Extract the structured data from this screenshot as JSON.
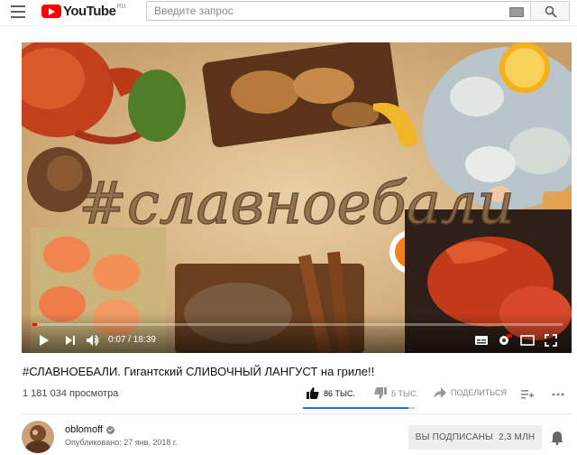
{
  "header": {
    "logo_text": "YouTube",
    "logo_country": "RU",
    "search_placeholder": "Введите запрос"
  },
  "player": {
    "overlay_text": "#славноебали",
    "current_time": "0:07",
    "duration": "18:39",
    "time_display": "0:07 / 18:39",
    "progress_fraction": 0.006
  },
  "video": {
    "title": "#СЛАВНОЕБАЛИ. Гигантский СЛИВОЧНЫЙ ЛАНГУСТ на гриле!!",
    "views": "1 181 034 просмотра",
    "likes": "86 ТЫС.",
    "dislikes": "5 ТЫС.",
    "share_label": "ПОДЕЛИТЬСЯ",
    "like_ratio": 0.945
  },
  "channel": {
    "name": "oblomoff",
    "published": "Опубликовано: 27 янв. 2018 г.",
    "subscribe_label": "ВЫ ПОДПИСАНЫ",
    "subscriber_count": "2,3 МЛН"
  },
  "colors": {
    "brand_red": "#ff0000",
    "like_blue": "#1e70d8",
    "sand": "#d8b88a"
  },
  "icons": [
    "menu-icon",
    "youtube-logo-icon",
    "keyboard-icon",
    "search-icon",
    "play-icon",
    "next-icon",
    "volume-icon",
    "subtitles-icon",
    "settings-icon",
    "miniplayer-icon",
    "fullscreen-icon",
    "like-icon",
    "dislike-icon",
    "share-icon",
    "add-to-playlist-icon",
    "more-icon",
    "verified-icon",
    "bell-icon"
  ]
}
